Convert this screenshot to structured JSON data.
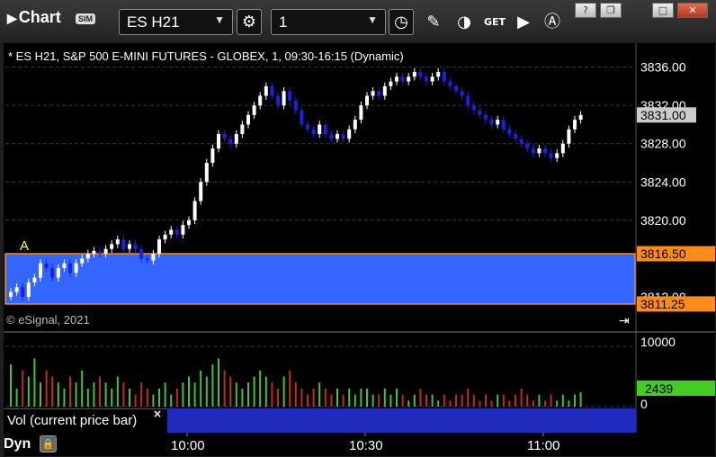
{
  "app": {
    "title": "Chart",
    "sim_badge": "SIM",
    "symbol": "ES H21",
    "interval": "1",
    "corner_controls": [
      "?",
      "❐",
      "□",
      "✕"
    ]
  },
  "toolbar_icons": [
    "settings-icon",
    "clock-icon",
    "pencil-icon",
    "study-icon",
    "get-icon",
    "play-icon",
    "cursor-icon"
  ],
  "chart": {
    "header": "* ES H21, S&P 500 E-MINI FUTURES - GLOBEX, 1, 09:30-16:15 (Dynamic)",
    "copyright": "© eSignal, 2021",
    "annotation": "A",
    "price_axis": [
      "3836.00",
      "3832.00",
      "3828.00",
      "3824.00",
      "3820.00",
      "3812.00"
    ],
    "price_tags": {
      "last": "3831.00",
      "upper": "3816.50",
      "lower": "3811.25"
    },
    "time_axis": [
      "10:00",
      "10:30",
      "11:00"
    ],
    "vol_axis": [
      "10000",
      "0"
    ],
    "vol_tag": "2439",
    "vol_label": "Vol (current price bar)",
    "vol_close": "×",
    "bottom_label": "Dyn",
    "colors": {
      "background": "#000000",
      "up": "#ffffff",
      "down": "#1a22e0",
      "zone_fill": "#3366ff",
      "zone_border": "#ff8c1a",
      "vol_up": "#3ec43e",
      "vol_down": "#c42a1a",
      "last_tag": "#cccccc",
      "vol_tag": "#44cc22",
      "annotation": "#ffff33"
    }
  },
  "chart_data": {
    "type": "candlestick",
    "interval_minutes": 1,
    "ylim": [
      3810.3,
      3838.5
    ],
    "time_labels_at_bar": {
      "10:00": 30,
      "10:30": 60,
      "11:00": 90
    },
    "zone": [
      3811.25,
      3816.5
    ],
    "close_series": [
      3812.5,
      3813.0,
      3812.0,
      3813.5,
      3814.0,
      3815.5,
      3815.0,
      3814.0,
      3815.0,
      3815.5,
      3814.5,
      3815.5,
      3816.0,
      3816.5,
      3816.8,
      3816.5,
      3817.0,
      3817.5,
      3818.0,
      3817.0,
      3817.5,
      3817.0,
      3816.0,
      3815.8,
      3816.5,
      3818.0,
      3818.5,
      3819.0,
      3818.5,
      3819.5,
      3820.0,
      3822.0,
      3824.0,
      3826.0,
      3827.5,
      3829.0,
      3828.5,
      3828.0,
      3829.0,
      3830.0,
      3831.0,
      3832.0,
      3833.0,
      3834.0,
      3833.0,
      3832.0,
      3833.5,
      3832.5,
      3831.5,
      3830.0,
      3829.5,
      3829.0,
      3830.0,
      3829.0,
      3828.5,
      3829.0,
      3828.5,
      3829.5,
      3830.5,
      3832.0,
      3833.0,
      3833.5,
      3833.0,
      3834.0,
      3834.5,
      3835.0,
      3834.5,
      3835.0,
      3835.5,
      3835.0,
      3834.5,
      3835.0,
      3835.5,
      3834.5,
      3834.0,
      3833.5,
      3833.0,
      3832.0,
      3831.5,
      3831.0,
      3830.5,
      3830.0,
      3830.5,
      3829.5,
      3829.0,
      3828.5,
      3828.0,
      3827.5,
      3827.0,
      3827.5,
      3827.0,
      3826.5,
      3827.0,
      3828.0,
      3829.5,
      3830.5,
      3831.0
    ],
    "volume_10k_scale": [
      7,
      3,
      6,
      5,
      8,
      4,
      6,
      5,
      4,
      3,
      5,
      4,
      6,
      3,
      4,
      5,
      4,
      3,
      5,
      4,
      3,
      2,
      4,
      3,
      2,
      3,
      4,
      2,
      3,
      4,
      5,
      4,
      6,
      5,
      7,
      8,
      6,
      5,
      4,
      3,
      4,
      5,
      6,
      5,
      4,
      3,
      5,
      6,
      4,
      3,
      2,
      3,
      4,
      3,
      2,
      3,
      2,
      3,
      2,
      3,
      3,
      2,
      2,
      3,
      2,
      3,
      2,
      1,
      2,
      3,
      2,
      2,
      1,
      2,
      1,
      2,
      2,
      3,
      2,
      1,
      2,
      1,
      2,
      2,
      1,
      2,
      3,
      2,
      1,
      2,
      1,
      2,
      1,
      2,
      1,
      2,
      2.4
    ]
  }
}
